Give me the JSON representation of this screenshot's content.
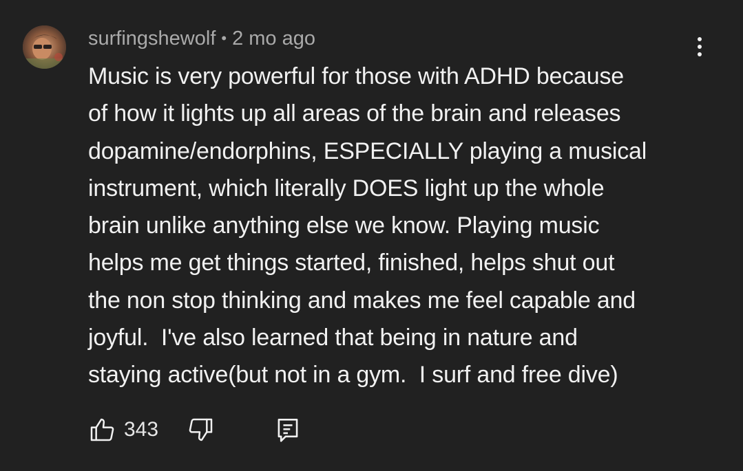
{
  "comment": {
    "author": "surfingshewolf",
    "separator": "•",
    "timestamp": "2 mo ago",
    "text": "Music is very powerful for those with ADHD because\nof how it lights up all areas of the brain and releases\ndopamine/endorphins, ESPECIALLY playing a musical\ninstrument, which literally DOES light up the whole\nbrain unlike anything else we know. Playing music\nhelps me get things started, finished, helps shut out\nthe non stop thinking and makes me feel capable and\njoyful.  I've also learned that being in nature and\nstaying active(but not in a gym.  I surf and free dive)",
    "like_count": "343"
  },
  "icons": {
    "avatar": "avatar-image",
    "more": "more-vertical-icon",
    "like": "thumbs-up-icon",
    "dislike": "thumbs-down-icon",
    "reply": "reply-comment-icon"
  },
  "colors": {
    "background": "#212121",
    "text_primary": "#f1f1f1",
    "text_secondary": "#aaaaaa"
  }
}
